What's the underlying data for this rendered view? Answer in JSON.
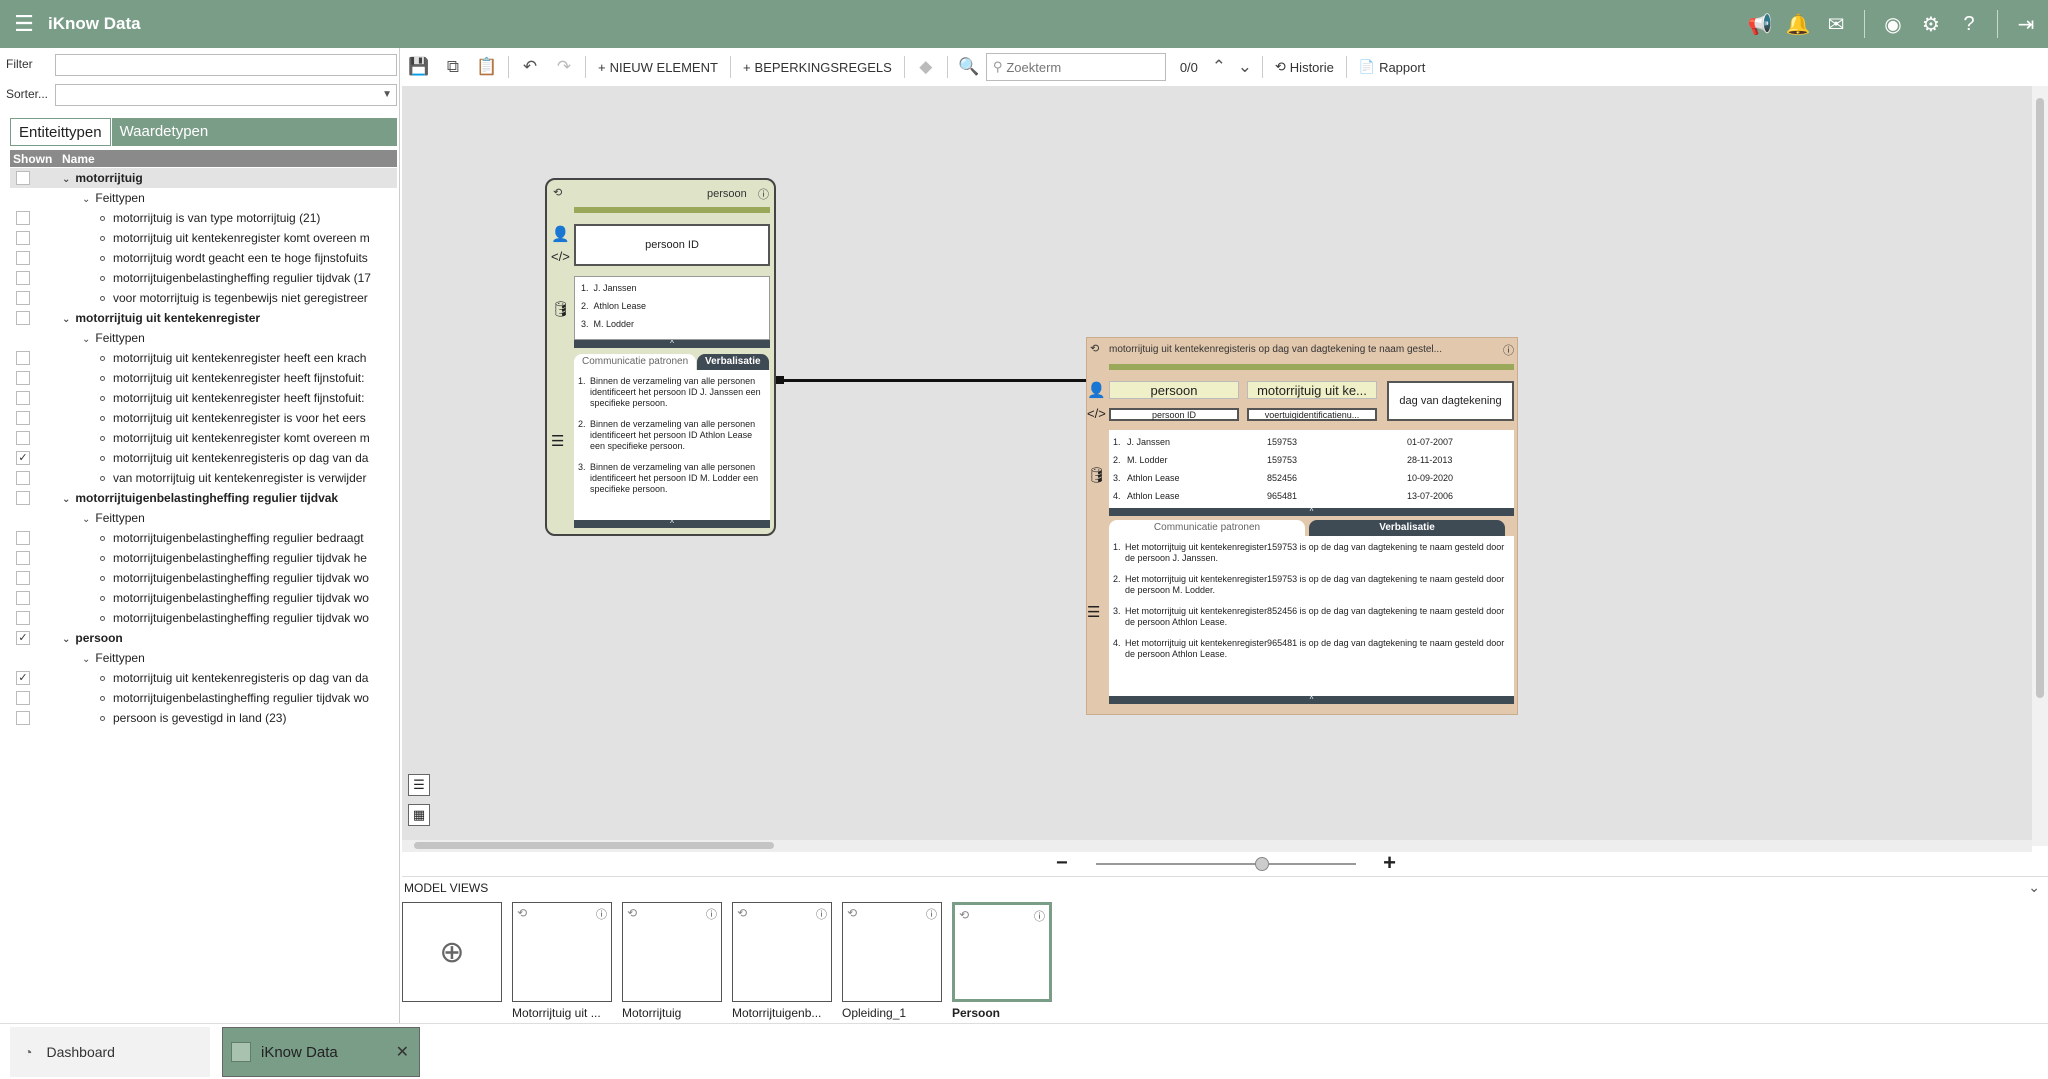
{
  "app": {
    "title": "iKnow Data"
  },
  "leftpanel": {
    "filter_label": "Filter",
    "sort_label": "Sorter...",
    "tabs": [
      {
        "label": "Entiteittypen"
      },
      {
        "label": "Waardetypen"
      }
    ],
    "tree_header": {
      "shown": "Shown",
      "name": "Name"
    },
    "tree": [
      {
        "level": 0,
        "label": "motorrijtuig",
        "checked": false,
        "selected": true
      },
      {
        "level": 1,
        "label": "Feittypen"
      },
      {
        "level": 2,
        "label": "motorrijtuig is van type motorrijtuig (21)",
        "checked": false
      },
      {
        "level": 2,
        "label": "motorrijtuig uit kentekenregister komt overeen m",
        "checked": false
      },
      {
        "level": 2,
        "label": "motorrijtuig wordt geacht een te hoge fijnstofuits",
        "checked": false
      },
      {
        "level": 2,
        "label": "motorrijtuigenbelastingheffing regulier tijdvak (17",
        "checked": false
      },
      {
        "level": 2,
        "label": "voor motorrijtuig is tegenbewijs niet geregistreer",
        "checked": false
      },
      {
        "level": 0,
        "label": "motorrijtuig uit kentekenregister",
        "checked": false
      },
      {
        "level": 1,
        "label": "Feittypen"
      },
      {
        "level": 2,
        "label": "motorrijtuig uit kentekenregister heeft een krach",
        "checked": false
      },
      {
        "level": 2,
        "label": "motorrijtuig uit kentekenregister heeft fijnstofuit:",
        "checked": false
      },
      {
        "level": 2,
        "label": "motorrijtuig uit kentekenregister heeft fijnstofuit:",
        "checked": false
      },
      {
        "level": 2,
        "label": "motorrijtuig uit kentekenregister is voor het eers",
        "checked": false
      },
      {
        "level": 2,
        "label": "motorrijtuig uit kentekenregister komt overeen m",
        "checked": false
      },
      {
        "level": 2,
        "label": "motorrijtuig uit kentekenregisteris op dag van da",
        "checked": true
      },
      {
        "level": 2,
        "label": "van motorrijtuig uit kentekenregister is verwijder",
        "checked": false
      },
      {
        "level": 0,
        "label": "motorrijtuigenbelastingheffing regulier tijdvak",
        "checked": false
      },
      {
        "level": 1,
        "label": "Feittypen"
      },
      {
        "level": 2,
        "label": "motorrijtuigenbelastingheffing regulier bedraagt",
        "checked": false
      },
      {
        "level": 2,
        "label": "motorrijtuigenbelastingheffing regulier tijdvak he",
        "checked": false
      },
      {
        "level": 2,
        "label": "motorrijtuigenbelastingheffing regulier tijdvak wo",
        "checked": false
      },
      {
        "level": 2,
        "label": "motorrijtuigenbelastingheffing regulier tijdvak wo",
        "checked": false
      },
      {
        "level": 2,
        "label": "motorrijtuigenbelastingheffing regulier tijdvak wo",
        "checked": false
      },
      {
        "level": 0,
        "label": "persoon",
        "checked": true
      },
      {
        "level": 1,
        "label": "Feittypen"
      },
      {
        "level": 2,
        "label": "motorrijtuig uit kentekenregisteris op dag van da",
        "checked": true
      },
      {
        "level": 2,
        "label": "motorrijtuigenbelastingheffing regulier tijdvak wo",
        "checked": false
      },
      {
        "level": 2,
        "label": "persoon is gevestigd in land (23)",
        "checked": false
      }
    ]
  },
  "toolbar": {
    "new_element": "NIEUW ELEMENT",
    "constraints": "BEPERKINGSREGELS",
    "search_placeholder": "Zoekterm",
    "search_count": "0/0",
    "history": "Historie",
    "report": "Rapport"
  },
  "entity_card": {
    "title": "persoon",
    "id_label": "persoon ID",
    "population": [
      "J. Janssen",
      "Athlon Lease",
      "M. Lodder"
    ],
    "tab_patterns": "Communicatie patronen",
    "tab_verbalisation": "Verbalisatie",
    "verbalisations": [
      "Binnen de verzameling van alle personen identificeert het persoon ID J. Janssen een specifieke persoon.",
      "Binnen de verzameling van alle personen identificeert het persoon ID Athlon Lease een specifieke persoon.",
      "Binnen de verzameling van alle personen identificeert het persoon ID M. Lodder een specifieke persoon."
    ]
  },
  "fact_card": {
    "title": "motorrijtuig uit kentekenregisteris op dag van dagtekening te naam gestel...",
    "roles": [
      {
        "name": "persoon",
        "id": "persoon ID"
      },
      {
        "name": "motorrijtuig uit ke...",
        "id": "voertuigidentificatienu..."
      },
      {
        "name": "dag van dagtekening",
        "id": ""
      }
    ],
    "rows": [
      [
        "J. Janssen",
        "159753",
        "01-07-2007"
      ],
      [
        "M. Lodder",
        "159753",
        "28-11-2013"
      ],
      [
        "Athlon Lease",
        "852456",
        "10-09-2020"
      ],
      [
        "Athlon Lease",
        "965481",
        "13-07-2006"
      ]
    ],
    "tab_patterns": "Communicatie patronen",
    "tab_verbalisation": "Verbalisatie",
    "verbalisations": [
      "Het motorrijtuig uit kentekenregister159753 is op de dag van dagtekening te naam gesteld door de persoon J. Janssen.",
      "Het motorrijtuig uit kentekenregister159753 is op de dag van dagtekening te naam gesteld door de persoon M. Lodder.",
      "Het motorrijtuig uit kentekenregister852456 is op de dag van dagtekening te naam gesteld door de persoon Athlon Lease.",
      "Het motorrijtuig uit kentekenregister965481 is op de dag van dagtekening te naam gesteld door de persoon Athlon Lease."
    ]
  },
  "zoom": {
    "level": 0.64
  },
  "model_views": {
    "header": "MODEL VIEWS",
    "items": [
      {
        "label": "Motorrijtuig uit ...",
        "active": false
      },
      {
        "label": "Motorrijtuig",
        "active": false
      },
      {
        "label": "Motorrijtuigenb...",
        "active": false
      },
      {
        "label": "Opleiding_1",
        "active": false
      },
      {
        "label": "Persoon",
        "active": true
      }
    ]
  },
  "bottom_tabs": {
    "dashboard": "Dashboard",
    "iknow": "iKnow Data"
  },
  "colors": {
    "brand": "#7a9d87",
    "entity_card_bg": "#dfe4c9",
    "fact_card_bg": "#e2c8ad",
    "olive_bar": "#9aa85a",
    "dark_bar": "#3e4a54"
  }
}
